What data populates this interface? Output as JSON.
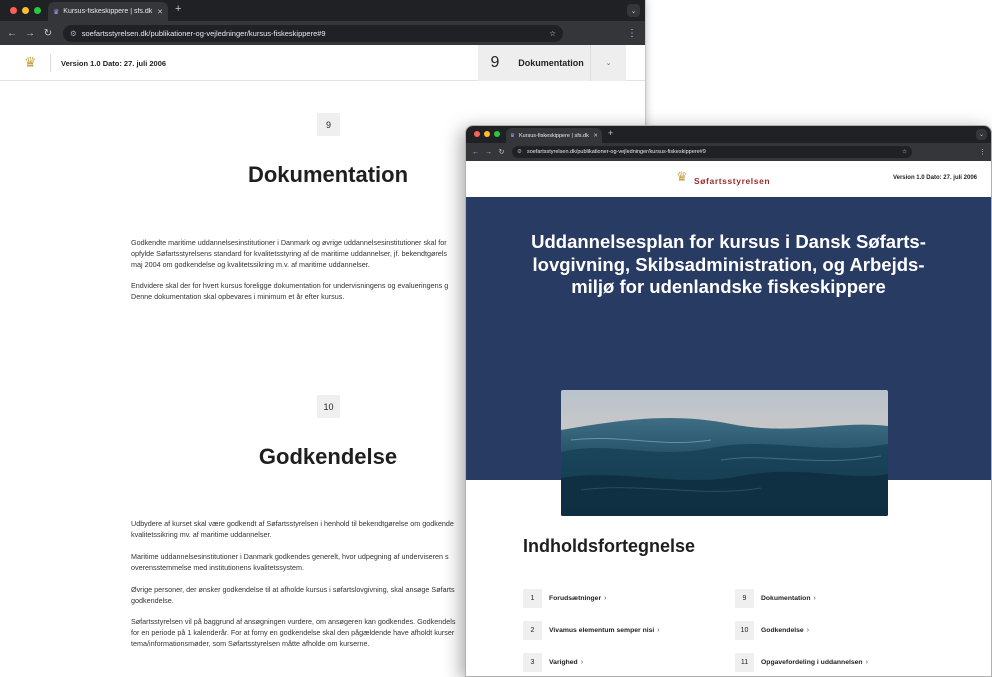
{
  "browser_back": {
    "tab_title": "Kursus-fiskeskippere | sfs.dk",
    "url": "soefartsstyrelsen.dk/publikationer-og-vejledninger/kursus-fiskeskippere#9"
  },
  "page_back": {
    "version": "Version 1.0 Dato: 27. juli 2006",
    "chapter_nav": {
      "number": "9",
      "label": "Dokumentation"
    },
    "sections": [
      {
        "number": "9",
        "title": "Dokumentation",
        "paragraphs": [
          [
            "Godkendte maritime uddannelsesinstitutioner i Danmark og øvrige uddannelsesinstitutioner skal for",
            "opfylde Søfartsstyrelsens standard for kvalitetsstyring af de maritime uddannelser, jf. bekendtgørels",
            "maj 2004 om godkendelse og kvalitetssikring m.v. af maritime uddannelser."
          ],
          [
            "Endvidere skal der for hvert kursus foreligge dokumentation for undervisningens og evalueringens g",
            "Denne dokumentation skal opbevares i minimum et år efter kursus."
          ]
        ]
      },
      {
        "number": "10",
        "title": "Godkendelse",
        "paragraphs": [
          [
            "Udbydere af kurset skal være godkendt af Søfartsstyrelsen i henhold til bekendtgørelse om godkende",
            "kvalitetssikring mv. af maritime uddannelser."
          ],
          [
            "Maritime uddannelsesinstitutioner i Danmark godkendes generelt, hvor udpegning af underviseren s",
            "overensstemmelse med institutionens kvalitetssystem."
          ],
          [
            "Øvrige personer, der ønsker godkendelse til at afholde kursus i søfartslovgivning, skal ansøge Søfarts",
            "godkendelse."
          ],
          [
            "Søfartsstyrelsen vil på baggrund af ansøgningen vurdere, om ansøgeren kan godkendes. Godkendels",
            "for en periode på 1 kalenderår. For at forny en godkendelse skal den pågældende have afholdt kurser",
            "tema/informationsmøder, som Søfartsstyrelsen måtte afholde om kurserne."
          ]
        ]
      }
    ]
  },
  "browser_front": {
    "tab_title": "Kursus-fiskeskippere | sfs.dk",
    "url": "soefartsstyrelsen.dk/publikationer-og-vejledninger/kursus-fiskeskippere#9"
  },
  "page_front": {
    "brand": "Søfartsstyrelsen",
    "version": "Version 1.0 Dato: 27. juli 2006",
    "hero_title_lines": [
      "Uddannelsesplan for kursus i Dansk Søfarts-",
      "lovgivning, Skibsadministration, og Arbejds-",
      "miljø for udenlandske fiskeskippere"
    ],
    "toc_title": "Indholdsfortegnelse",
    "toc": [
      {
        "number": "1",
        "label": "Forudsætninger"
      },
      {
        "number": "9",
        "label": "Dokumentation"
      },
      {
        "number": "2",
        "label": "Vivamus elementum semper nisi"
      },
      {
        "number": "10",
        "label": "Godkendelse"
      },
      {
        "number": "3",
        "label": "Varighed"
      },
      {
        "number": "11",
        "label": "Opgavefordeling i uddannelsen"
      }
    ]
  },
  "icons": {
    "crown": "crown-logo",
    "back": "arrow-left-icon",
    "forward": "arrow-right-icon",
    "reload": "reload-icon",
    "bookmark": "star-icon",
    "menu": "kebab-menu-icon",
    "chevron": "chevron-down-icon",
    "toc_arrow": "chevron-right-icon"
  },
  "colors": {
    "hero_background": "#283b63",
    "brand_red": "#9a2a2a",
    "crown_gold": "#c8a24a",
    "browser_chrome": "#202124"
  }
}
